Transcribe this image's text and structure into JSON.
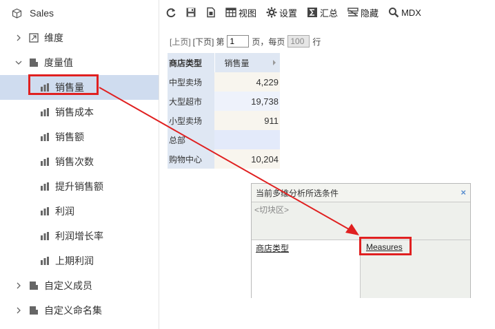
{
  "sidebar": {
    "root": "Sales",
    "items": [
      {
        "label": "维度",
        "kind": "folder-dimension",
        "expanded": false
      },
      {
        "label": "度量值",
        "kind": "folder-measure",
        "expanded": true
      },
      {
        "label": "销售量",
        "kind": "measure",
        "selected": true
      },
      {
        "label": "销售成本",
        "kind": "measure"
      },
      {
        "label": "销售额",
        "kind": "measure"
      },
      {
        "label": "销售次数",
        "kind": "measure"
      },
      {
        "label": "提升销售额",
        "kind": "measure"
      },
      {
        "label": "利润",
        "kind": "measure"
      },
      {
        "label": "利润增长率",
        "kind": "measure"
      },
      {
        "label": "上期利润",
        "kind": "measure"
      },
      {
        "label": "自定义成员",
        "kind": "folder",
        "expanded": false
      },
      {
        "label": "自定义命名集",
        "kind": "folder",
        "expanded": false
      }
    ]
  },
  "toolbar": {
    "refresh_icon": "refresh-icon",
    "save_icon": "save-icon",
    "export_icon": "export-icon",
    "view_label": "视图",
    "settings_label": "设置",
    "summary_label": "汇总",
    "hide_label": "隐藏",
    "mdx_label": "MDX"
  },
  "pager": {
    "prev": "[上页]",
    "next": "[下页]",
    "page_prefix": "第",
    "page_value": "1",
    "page_suffix": "页，每页",
    "per_page_value": "100",
    "rows_suffix": "行"
  },
  "grid": {
    "headers": [
      "商店类型",
      "销售量"
    ],
    "rows": [
      {
        "type": "中型卖场",
        "value": "4,229"
      },
      {
        "type": "大型超市",
        "value": "19,738"
      },
      {
        "type": "小型卖场",
        "value": "911"
      },
      {
        "type": "总部",
        "value": ""
      },
      {
        "type": "购物中心",
        "value": "10,204"
      }
    ]
  },
  "panel": {
    "title": "当前多维分析所选条件",
    "close": "×",
    "slice_label": "<切块区>",
    "row_field": "商店类型",
    "col_field": "Measures"
  },
  "colors": {
    "selected_bg": "#cfdcef",
    "highlight": "#e02020",
    "header_bg": "#dfe7f3"
  }
}
